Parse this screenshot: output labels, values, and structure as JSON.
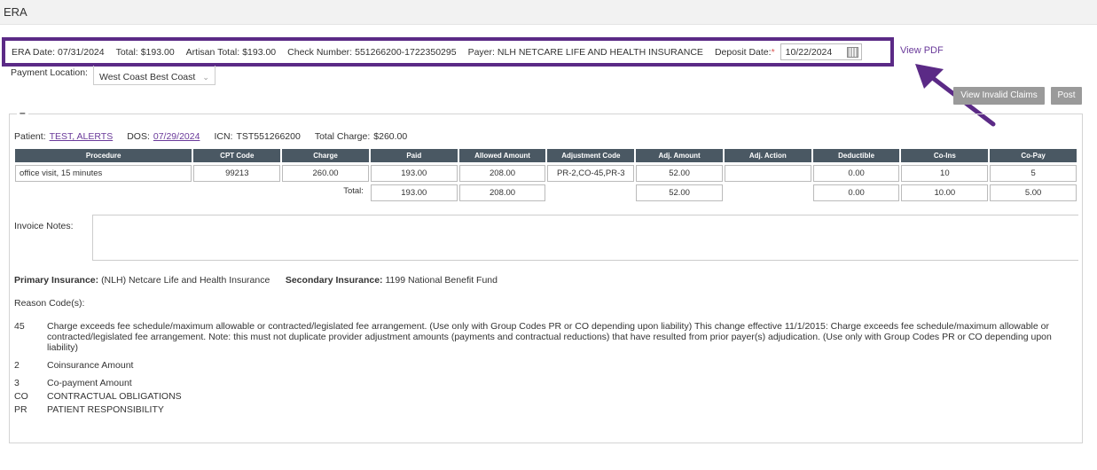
{
  "page": {
    "title": "ERA"
  },
  "era_header": {
    "era_date_label": "ERA Date:",
    "era_date": "07/31/2024",
    "total_label": "Total:",
    "total": "$193.00",
    "artisan_total_label": "Artisan Total:",
    "artisan_total": "$193.00",
    "check_number_label": "Check Number:",
    "check_number": "551266200-1722350295",
    "payer_label": "Payer:",
    "payer": "NLH NETCARE LIFE AND HEALTH INSURANCE",
    "deposit_date_label": "Deposit Date:",
    "required_mark": "*",
    "deposit_date": "10/22/2024"
  },
  "view_pdf_label": "View PDF",
  "payment_location": {
    "label": "Payment Location:",
    "value": "West Coast Best Coast"
  },
  "buttons": {
    "view_invalid_claims": "View Invalid Claims",
    "post": "Post"
  },
  "panel": {
    "collapse_symbol": "–"
  },
  "patient": {
    "patient_label": "Patient:",
    "patient_name": "TEST, ALERTS",
    "dos_label": "DOS:",
    "dos": "07/29/2024",
    "icn_label": "ICN:",
    "icn": "TST551266200",
    "total_charge_label": "Total Charge:",
    "total_charge": "$260.00"
  },
  "table": {
    "headers": [
      "Procedure",
      "CPT Code",
      "Charge",
      "Paid",
      "Allowed Amount",
      "Adjustment Code",
      "Adj. Amount",
      "Adj. Action",
      "Deductible",
      "Co-Ins",
      "Co-Pay"
    ],
    "rows": [
      [
        "office visit, 15 minutes",
        "99213",
        "260.00",
        "193.00",
        "208.00",
        "PR-2,CO-45,PR-3",
        "52.00",
        "",
        "0.00",
        "10",
        "5"
      ]
    ],
    "total_label": "Total:",
    "totals": {
      "paid": "193.00",
      "allowed": "208.00",
      "adj_amount": "52.00",
      "deductible": "0.00",
      "coins": "10.00",
      "copay": "5.00"
    }
  },
  "invoice_notes_label": "Invoice Notes:",
  "insurance": {
    "primary_label": "Primary Insurance:",
    "primary": "(NLH) Netcare Life and Health Insurance",
    "secondary_label": "Secondary Insurance:",
    "secondary": "1199 National Benefit Fund"
  },
  "reason_codes_title": "Reason Code(s):",
  "reason_codes": [
    {
      "code": "45",
      "desc": "Charge exceeds fee schedule/maximum allowable or contracted/legislated fee arrangement. (Use only with Group Codes PR or CO depending upon liability) This change effective 11/1/2015: Charge exceeds fee schedule/maximum allowable or contracted/legislated fee arrangement. Note: this must not duplicate provider adjustment amounts (payments and contractual reductions) that have resulted from prior payer(s) adjudication. (Use only with Group Codes PR or CO depending upon liability)"
    },
    {
      "code": "2",
      "desc": "Coinsurance Amount"
    },
    {
      "code": "3",
      "desc": "Co-payment Amount"
    },
    {
      "code": "CO",
      "desc": "CONTRACTUAL OBLIGATIONS"
    },
    {
      "code": "PR",
      "desc": "PATIENT RESPONSIBILITY"
    }
  ],
  "colors": {
    "highlight_border": "#5b2a86",
    "arrow": "#5b2a86",
    "header_bg": "#4a5863",
    "link": "#6a3a9a",
    "button_bg": "#9a9a9a"
  },
  "icons": {
    "calendar": "calendar-icon",
    "dropdown": "chevron-down-icon",
    "annotation_arrow": "arrow-icon"
  }
}
